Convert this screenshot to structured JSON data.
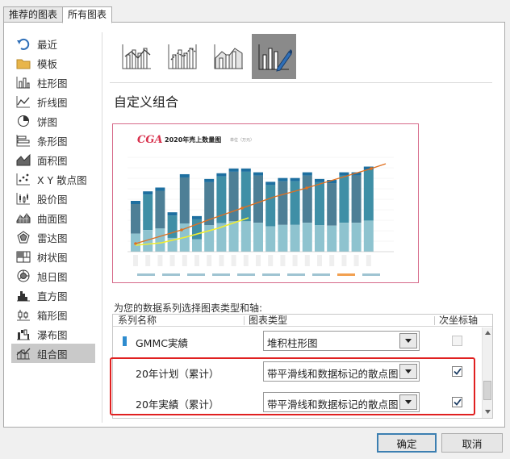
{
  "tabs": [
    "推荐的图表",
    "所有图表"
  ],
  "sidebar": {
    "items": [
      {
        "label": "最近",
        "icon": "recent-icon"
      },
      {
        "label": "模板",
        "icon": "folder-icon"
      },
      {
        "label": "柱形图",
        "icon": "column-chart-icon"
      },
      {
        "label": "折线图",
        "icon": "line-chart-icon"
      },
      {
        "label": "饼图",
        "icon": "pie-chart-icon"
      },
      {
        "label": "条形图",
        "icon": "bar-chart-icon"
      },
      {
        "label": "面积图",
        "icon": "area-chart-icon"
      },
      {
        "label": "X Y 散点图",
        "icon": "scatter-chart-icon"
      },
      {
        "label": "股价图",
        "icon": "stock-chart-icon"
      },
      {
        "label": "曲面图",
        "icon": "surface-chart-icon"
      },
      {
        "label": "雷达图",
        "icon": "radar-chart-icon"
      },
      {
        "label": "树状图",
        "icon": "treemap-chart-icon"
      },
      {
        "label": "旭日图",
        "icon": "sunburst-chart-icon"
      },
      {
        "label": "直方图",
        "icon": "histogram-chart-icon"
      },
      {
        "label": "箱形图",
        "icon": "box-chart-icon"
      },
      {
        "label": "瀑布图",
        "icon": "waterfall-chart-icon"
      },
      {
        "label": "组合图",
        "icon": "combo-chart-icon"
      }
    ],
    "selected_index": 16
  },
  "subtypes": [
    "clustered-column-line-icon",
    "clustered-column-line-secondary-icon",
    "stacked-area-column-icon",
    "custom-combo-icon"
  ],
  "section_title": "自定义组合",
  "preview": {
    "brand": "CGA",
    "title": "2020年売上数量图",
    "unit": "单位（万元）"
  },
  "series_prompt": "为您的数据系列选择图表类型和轴:",
  "series_table": {
    "headers": [
      "系列名称",
      "图表类型",
      "次坐标轴"
    ],
    "rows": [
      {
        "name": "GMMC実績",
        "type": "堆积柱形图",
        "secondary_axis": false,
        "secondary_enabled": false,
        "marker": true
      },
      {
        "name": "20年计划（累计）",
        "type": "带平滑线和数据标记的散点图",
        "secondary_axis": true,
        "secondary_enabled": true,
        "marker": false
      },
      {
        "name": "20年実績（累计）",
        "type": "带平滑线和数据标记的散点图",
        "secondary_axis": true,
        "secondary_enabled": true,
        "marker": false
      }
    ]
  },
  "buttons": {
    "ok": "确定",
    "cancel": "取消"
  },
  "colors": {
    "accent": "#3c7fb1",
    "highlight": "#e02020",
    "brand": "#d8304c",
    "series_marker": "#2e8ccf"
  }
}
